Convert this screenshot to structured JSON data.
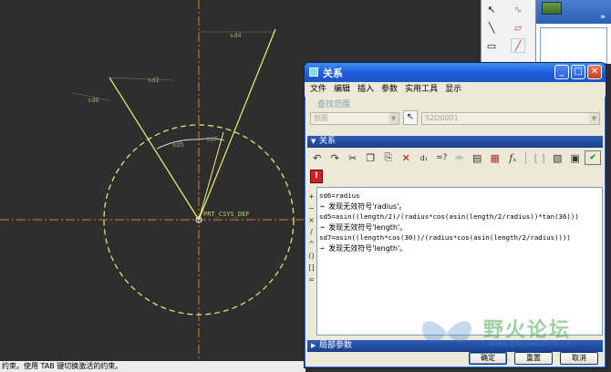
{
  "viewport": {
    "dimensions": [
      {
        "id": "sd4",
        "label": "sd4"
      },
      {
        "id": "sd2",
        "label": "sd2"
      },
      {
        "id": "sd6",
        "label": "sd6"
      },
      {
        "id": "sd5",
        "label": "sd5"
      },
      {
        "id": "sd7",
        "label": "sd7"
      }
    ],
    "csys_label": "PRT_CSYS_DEF",
    "colors": {
      "background": "#2e2e2e",
      "geometry": "#f0f07a",
      "dimension": "#a0a070",
      "axis": "#e07a2a"
    }
  },
  "status": {
    "message": "约束。使用 TAB 键切换激活的约束。"
  },
  "dialog": {
    "title": "关系",
    "menu": [
      "文件",
      "编辑",
      "插入",
      "参数",
      "实用工具",
      "显示"
    ],
    "scope": {
      "label": "查找范围",
      "type_value": "剖面",
      "object_value": "S2D0001"
    },
    "relations_section": "关系",
    "relations": [
      {
        "text": "sd6=radius",
        "error": "发现无效符号'radius'。"
      },
      {
        "text": "sd5=asin((length/2)/(radius*cos(asin(length/2/radius))*tan(36)))",
        "error": "发现无效符号'length'。"
      },
      {
        "text": "sd7=asin((length*cos(30))/(radius*cos(asin(length/2/radius))))",
        "error": "发现无效符号'length'。"
      }
    ],
    "operators": [
      "+",
      "−",
      "×",
      "/",
      "^",
      "()",
      "[]",
      "="
    ],
    "local_params_section": "局部参数",
    "buttons": {
      "ok": "确定",
      "reset": "重置",
      "cancel": "取消"
    }
  },
  "watermark": {
    "text": "野火论坛",
    "sub": "www.proewildfire.cn"
  }
}
